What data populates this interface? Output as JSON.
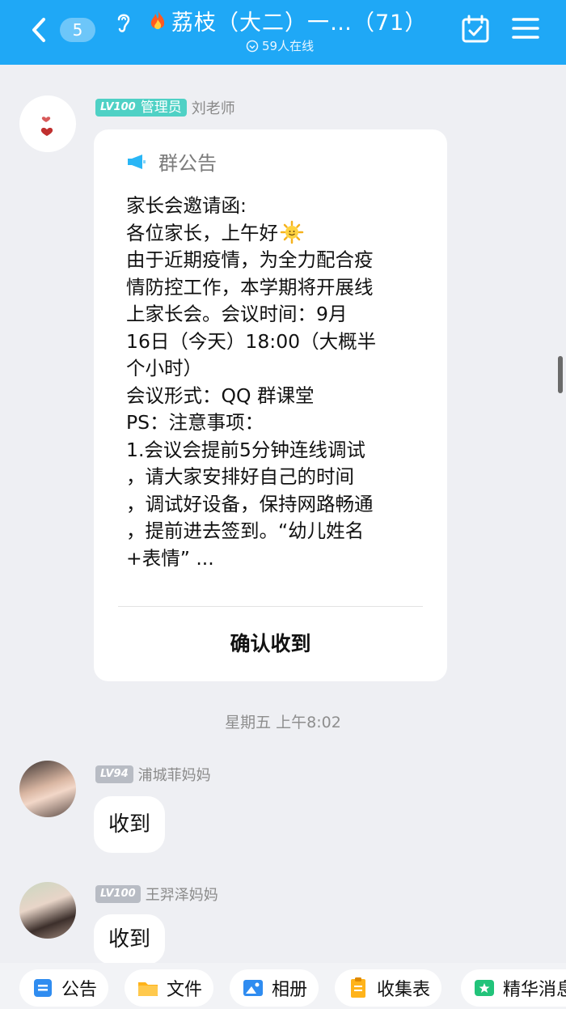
{
  "header": {
    "unread_count": "5",
    "title": "荔枝（大二）一…（71）",
    "online_text": "59人在线"
  },
  "messages": [
    {
      "level": "LV100",
      "role": "管理员",
      "sender": "刘老师",
      "notice": {
        "title": "群公告",
        "lines": [
          "家长会邀请函:",
          "各位家长，上午好",
          "由于近期疫情，为全力配合疫",
          "情防控工作，本学期将开展线",
          "上家长会。会议时间：9月",
          "16日（今天）18:00（大概半",
          "个小时）",
          "会议形式：QQ 群课堂",
          "PS：注意事项：",
          "1.会议会提前5分钟连线调试",
          "，请大家安排好自己的时间",
          "，调试好设备，保持网路畅通",
          "，提前进去签到。“幼儿姓名",
          "+表情” ..."
        ],
        "confirm_label": "确认收到"
      }
    }
  ],
  "timestamp": "星期五 上午8:02",
  "replies": [
    {
      "level": "LV94",
      "sender": "浦城菲妈妈",
      "text": "收到"
    },
    {
      "level": "LV100",
      "sender": "王羿泽妈妈",
      "text": "收到"
    }
  ],
  "toolbar": {
    "items": [
      {
        "label": "公告",
        "icon": "announcement-icon"
      },
      {
        "label": "文件",
        "icon": "folder-icon"
      },
      {
        "label": "相册",
        "icon": "album-icon"
      },
      {
        "label": "收集表",
        "icon": "form-icon"
      },
      {
        "label": "精华消息",
        "icon": "featured-icon"
      }
    ]
  },
  "colors": {
    "header_bg": "#1fa8f6",
    "admin_badge": "#4fd1c5",
    "level_badge_grey": "#b8bcc4",
    "page_bg": "#eeeff3"
  }
}
